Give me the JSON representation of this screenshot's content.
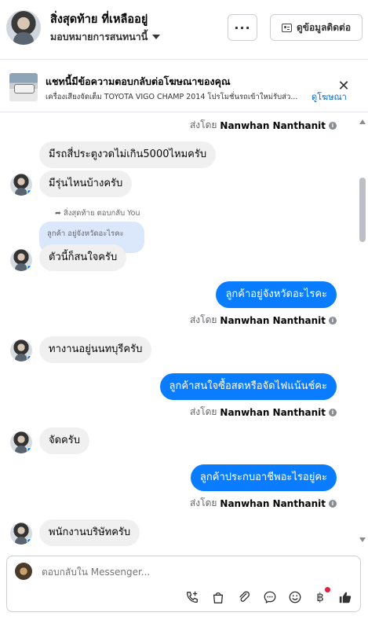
{
  "header": {
    "name": "สิ่งสุดท้าย ที่เหลืออยู่",
    "subtitle": "มอบหมายการสนทนานี้",
    "more_label": "···",
    "contact_label": "ดูข้อมูลติดต่อ"
  },
  "ad": {
    "title": "แชทนี้มีข้อความตอบกลับต่อโฆษณาของคุณ",
    "description": "เครื่องเสียงจัดเต็ม TOYOTA VIGO CHAMP 2014 โปรโมชั่นรถเข้าใหม่รับส่ว...",
    "link": "ดูโฆษณา",
    "close": "✕"
  },
  "conversation": {
    "sent_by_prefix": "ส่งโดย",
    "sent_by_name": "Nanwhan Nanthanit",
    "reply_note": "สิ่งสุดท้าย ตอบกลับ You",
    "quoted_text": "ลูกค้า อยู่จังหวัดอะไรคะ",
    "messages": [
      {
        "side": "in",
        "text": "มีรถสี่ประตูงวดไม่เกิน5000ไหมครับ"
      },
      {
        "side": "in",
        "text": "มีรุ่นไหนบ้างครับ"
      },
      {
        "side": "in",
        "text": "ตัวนี้ก็สนใจครับ"
      },
      {
        "side": "out",
        "text": "ลูกค้าอยู่จังหวัดอะไรคะ"
      },
      {
        "side": "in",
        "text": "ทางานอยู่นนทบุรีครับ"
      },
      {
        "side": "out",
        "text": "ลูกค้าสนใจซื้อสดหรือจัดไฟแน้นช์คะ"
      },
      {
        "side": "in",
        "text": "จัดครับ"
      },
      {
        "side": "out",
        "text": "ลูกค้าประกบอาชีพอะไรอยู่คะ"
      },
      {
        "side": "in",
        "text": "พนักงานบริษัทครับ"
      }
    ]
  },
  "composer": {
    "placeholder": "ตอบกลับใน Messenger...",
    "baht_symbol": "฿"
  },
  "colors": {
    "outgoing_bubble": "#0a7cff",
    "incoming_bubble": "#f0f0f0",
    "link": "#0064d1",
    "notification": "#e41e3f"
  },
  "icons": [
    "contact-card-icon",
    "close-icon",
    "call-add-icon",
    "bag-icon",
    "paperclip-icon",
    "chat-bubble-icon",
    "smiley-icon",
    "baht-icon",
    "thumbs-up-icon"
  ]
}
